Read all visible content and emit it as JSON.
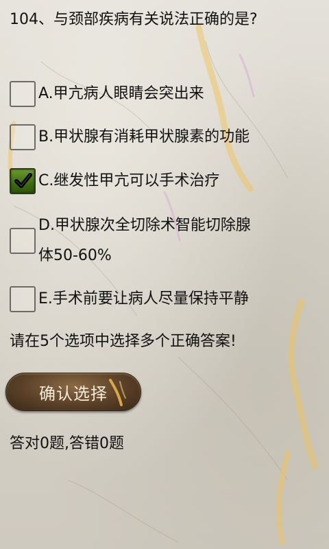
{
  "question": {
    "text": "104、与颈部疾病有关说法正确的是?"
  },
  "options": [
    {
      "label": "A.甲亢病人眼睛会突出来",
      "checked": false
    },
    {
      "label": "B.甲状腺有消耗甲状腺素的功能",
      "checked": false
    },
    {
      "label": "C.继发性甲亢可以手术治疗",
      "checked": true
    },
    {
      "label_line1": "D.甲状腺次全切除术智能切除腺",
      "label_line2": "体50-60%",
      "checked": false
    },
    {
      "label": "E.手术前要让病人尽量保持平静",
      "checked": false
    }
  ],
  "hint": {
    "text": "请在5个选项中选择多个正确答案!"
  },
  "confirm_button": {
    "label": "确认选择"
  },
  "score": {
    "text": "答对0题,答错0题"
  },
  "colors": {
    "background": "#d9d6cd",
    "checked_green": "#4f7f1b",
    "button_brown": "#5a4027",
    "text": "#111111"
  },
  "icons": {
    "checkbox_checked": "check-icon",
    "button_decoration": "cordyceps-decoration"
  }
}
